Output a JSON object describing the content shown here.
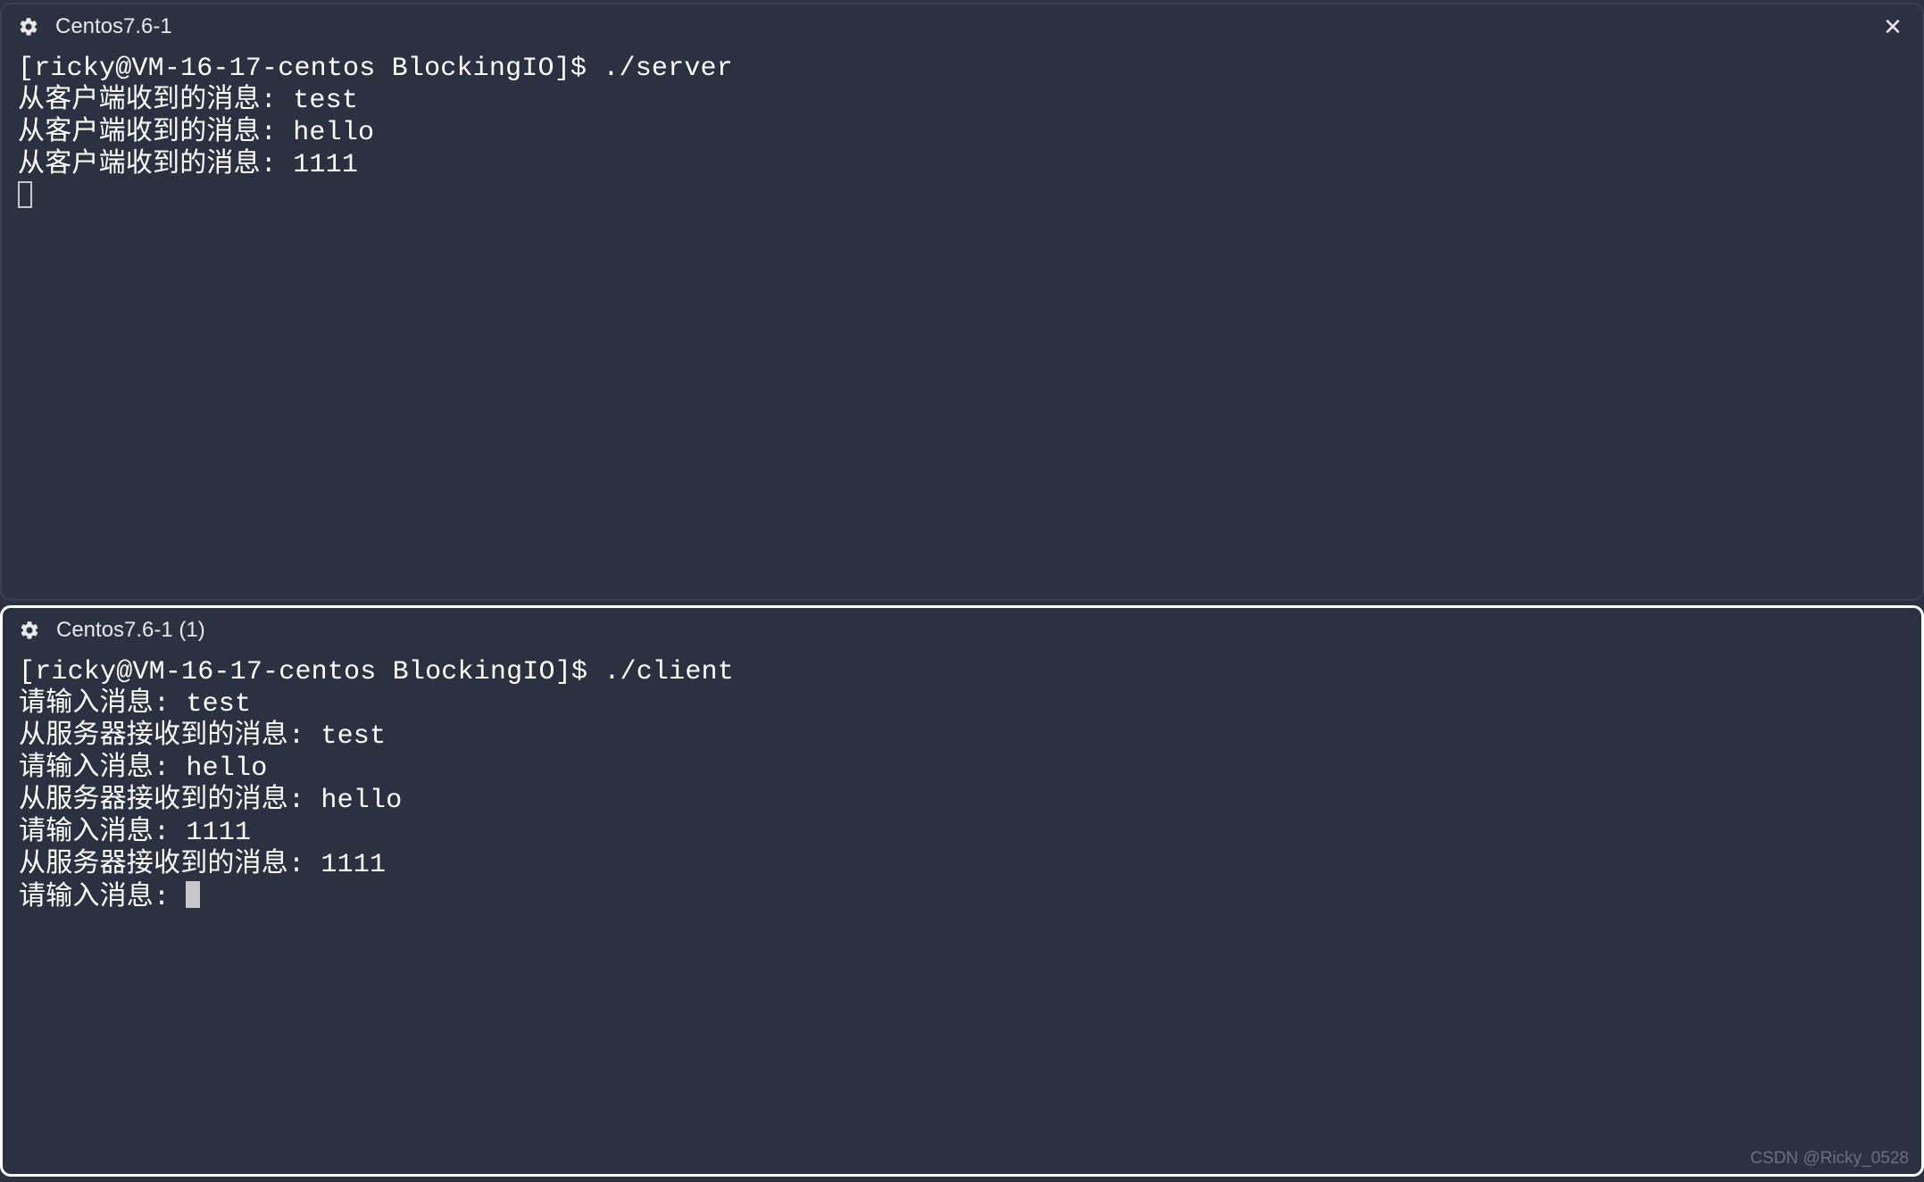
{
  "top_pane": {
    "title": "Centos7.6-1",
    "prompt": "[ricky@VM-16-17-centos BlockingIO]$ ",
    "command": "./server",
    "lines": [
      "从客户端收到的消息: test",
      "从客户端收到的消息: hello",
      "从客户端收到的消息: 1111"
    ]
  },
  "bottom_pane": {
    "title": "Centos7.6-1 (1)",
    "prompt": "[ricky@VM-16-17-centos BlockingIO]$ ",
    "command": "./client",
    "lines": [
      "请输入消息: test",
      "从服务器接收到的消息: test",
      "请输入消息: hello",
      "从服务器接收到的消息: hello",
      "请输入消息: 1111",
      "从服务器接收到的消息: 1111",
      "请输入消息: "
    ]
  },
  "watermark": "CSDN @Ricky_0528"
}
